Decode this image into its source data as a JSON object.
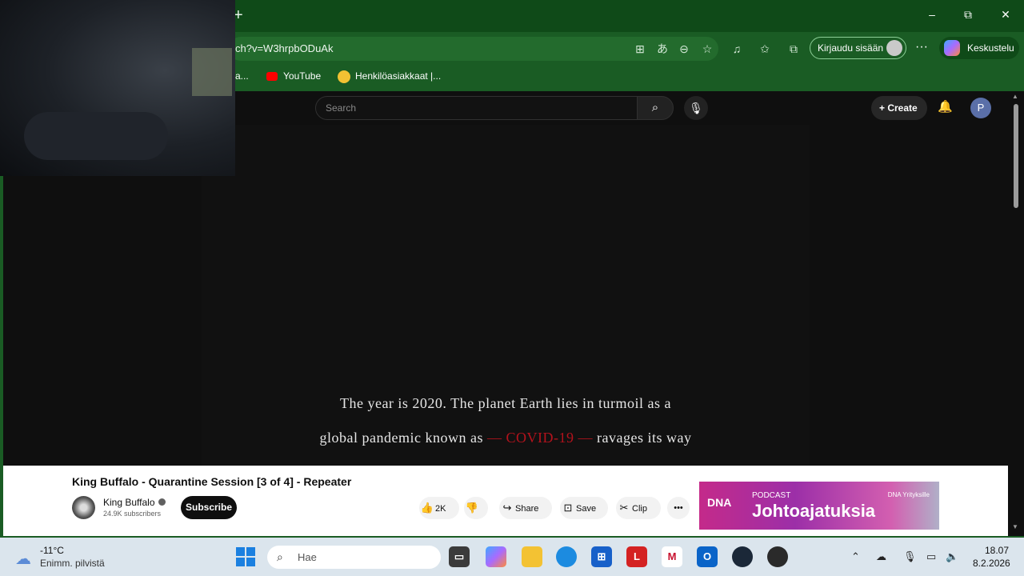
{
  "browser": {
    "new_tab_symbol": "+",
    "window_controls": [
      "–",
      "⧉",
      "✕"
    ],
    "url": "ch?v=W3hrpbODuAk",
    "signin_label": "Kirjaudu sisään",
    "copilot_label": "Keskustelu",
    "favorites": [
      {
        "label": "a..."
      },
      {
        "label": "YouTube"
      },
      {
        "label": "Henkilöasiakkaat |..."
      }
    ]
  },
  "youtube": {
    "search_placeholder": "Search",
    "create_label": "Create",
    "avatar_letter": "P",
    "subtitles": {
      "line1": "The year is 2020. The planet Earth lies in turmoil as a",
      "line2_before": "global pandemic known as",
      "line2_highlight": "— COVID-19 —",
      "line2_after": "ravages its way"
    },
    "video_title": "King Buffalo - Quarantine Session [3 of 4] - Repeater",
    "channel_name": "King Buffalo",
    "channel_subs": "24.9K subscribers",
    "subscribe_label": "Subscribe",
    "actions": {
      "likes": "2K",
      "share": "Share",
      "save": "Save",
      "clip": "Clip",
      "more": "•••"
    },
    "ad": {
      "brand": "DNA",
      "tag": "PODCAST",
      "headline": "Johtoajatuksia",
      "sponsor": "DNA Yrityksille"
    }
  },
  "taskbar": {
    "weather_temp": "-11°C",
    "weather_desc": "Enimm. pilvistä",
    "search_placeholder": "Hae",
    "clock_time": "18.07",
    "clock_date": "8.2.2026"
  },
  "colors": {
    "browser_frame": "#1a5c24",
    "youtube_bg": "#0f0f0f",
    "covid_red": "#b3121c"
  }
}
